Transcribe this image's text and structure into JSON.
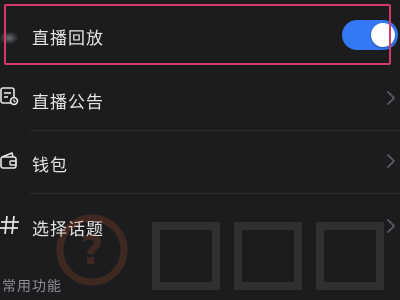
{
  "settings": {
    "items": [
      {
        "label": "直播回放",
        "icon": "blurred-avatar-icon",
        "control": "toggle",
        "toggle_on": true
      },
      {
        "label": "直播公告",
        "icon": "announcement-icon",
        "control": "chevron"
      },
      {
        "label": "钱包",
        "icon": "wallet-icon",
        "control": "chevron"
      },
      {
        "label": "选择话题",
        "icon": "hashtag-icon",
        "control": "chevron"
      }
    ],
    "section_header": "常用功能"
  },
  "colors": {
    "background": "#1c1c1e",
    "highlight": "#d43a66",
    "toggle_on": "#3478f6"
  },
  "watermark": {
    "icon": "question-mark-logo",
    "mark_color": "#e0622c"
  }
}
